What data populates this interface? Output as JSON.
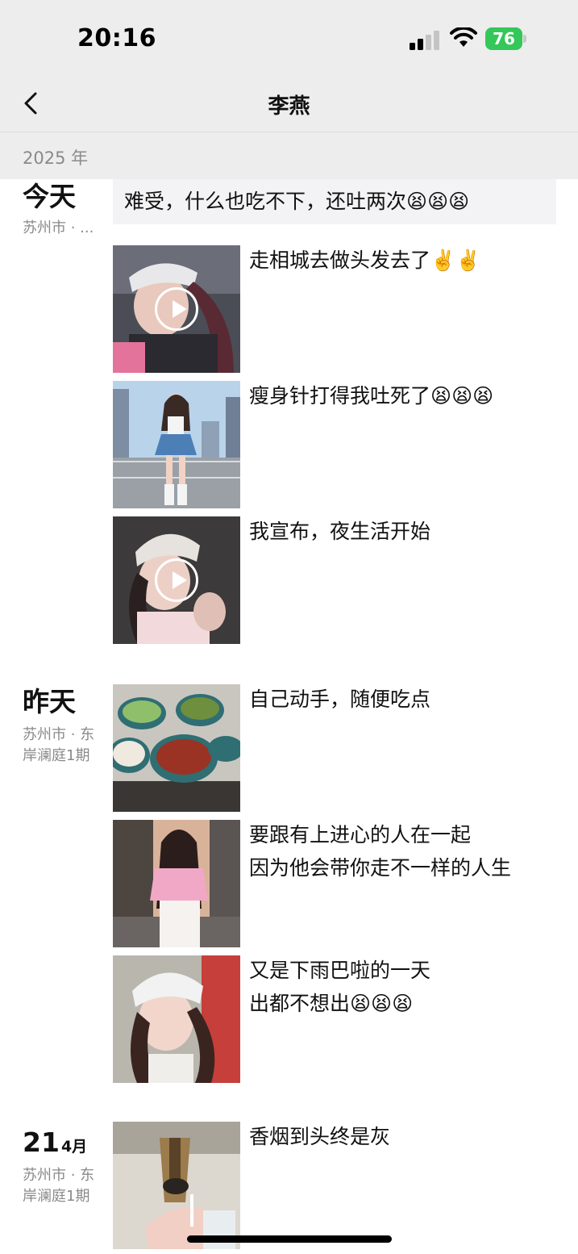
{
  "status_bar": {
    "time": "20:16",
    "battery": "76"
  },
  "nav": {
    "title": "李燕"
  },
  "year": "2025 年",
  "days": [
    {
      "title": "今天",
      "location": "苏州市 · ...",
      "text_post": "难受，什么也吃不下，还吐两次😫😫😫",
      "posts": [
        {
          "caption": "走相城去做头发去了✌️✌️",
          "video": true
        },
        {
          "caption": "瘦身针打得我吐死了😫😫😫",
          "video": false
        },
        {
          "caption": "我宣布，夜生活开始",
          "video": true
        }
      ]
    },
    {
      "title": "昨天",
      "location": "苏州市 · 东岸澜庭1期",
      "posts": [
        {
          "caption": "自己动手，随便吃点",
          "video": false
        },
        {
          "caption": "要跟有上进心的人在一起\n因为他会带你走不一样的人生",
          "video": false
        },
        {
          "caption": "又是下雨巴啦的一天\n出都不想出😫😫😫",
          "video": false
        }
      ]
    },
    {
      "title_day": "21",
      "title_month": "4月",
      "location": "苏州市 · 东岸澜庭1期",
      "posts": [
        {
          "caption": "香烟到头终是灰",
          "video": false
        }
      ]
    }
  ]
}
